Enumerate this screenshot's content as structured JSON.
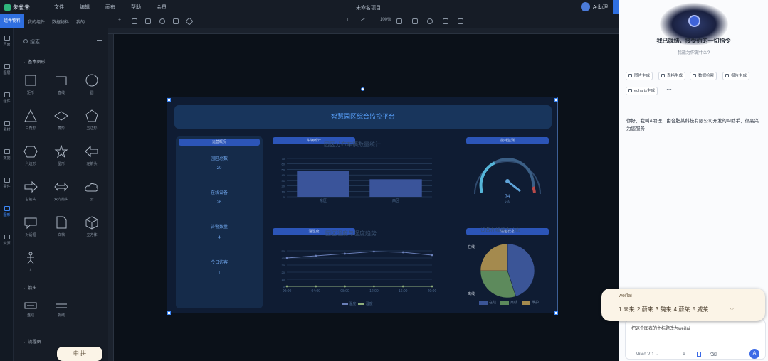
{
  "app": {
    "name": "朱雀朱",
    "menu": [
      "文件",
      "编辑",
      "画布",
      "帮助",
      "会员"
    ],
    "project_title": "未命名项目",
    "user": "A·助理"
  },
  "left_tabs": [
    "组件物料",
    "我的组件",
    "数据物料",
    "我的"
  ],
  "rail": [
    {
      "label": "页面",
      "active": false
    },
    {
      "label": "图层",
      "active": false
    },
    {
      "label": "组件",
      "active": false
    },
    {
      "label": "素材",
      "active": false
    },
    {
      "label": "数据",
      "active": false
    },
    {
      "label": "事件",
      "active": false
    },
    {
      "label": "图形",
      "active": true
    },
    {
      "label": "资源",
      "active": false
    }
  ],
  "palette": {
    "search_placeholder": "搜索",
    "section_basic": "基本图形",
    "section_arrow": "箭头",
    "section_more": "流程图",
    "shapes": [
      "矩形",
      "直线",
      "圆",
      "三角形",
      "菱形",
      "五边形",
      "六边形",
      "星形",
      "左箭头",
      "右箭头",
      "双向箭头",
      "云",
      "对话框",
      "文档",
      "立方体",
      "人"
    ],
    "arrows": [
      "连线",
      "折线"
    ],
    "ime_badge": "中 拼"
  },
  "toolbar": {
    "zoom": "100%",
    "text_tool": "T"
  },
  "dashboard": {
    "title": "智慧园区综合监控平台",
    "left_card_chip": "运营概况",
    "left_items": [
      {
        "label": "园区总数",
        "value": "20"
      },
      {
        "label": "在线设备",
        "value": "26"
      },
      {
        "label": "告警数量",
        "value": "4"
      },
      {
        "label": "今日访客",
        "value": "1"
      }
    ],
    "bar_chip": "车辆统计",
    "bar_ghost": "园区分布车辆数量统计",
    "gauge_chip": "能耗监测",
    "gauge_value": "74",
    "gauge_unit": "kW",
    "line_chip": "温湿度",
    "line_ghost": "园区温度与湿度趋势",
    "pie_chip": "设备状态",
    "pie_ghost": "设备在线状态分布",
    "line_legend": [
      "温度",
      "湿度"
    ],
    "pie_legend": [
      "在线",
      "离线",
      "维护"
    ],
    "pie_labels": [
      "在线",
      "离线"
    ]
  },
  "chart_data": [
    {
      "type": "bar",
      "categories": [
        "东区",
        "西区"
      ],
      "values": [
        48,
        32
      ],
      "ylim": [
        0,
        70
      ],
      "yticks": [
        "0",
        "10",
        "20",
        "30",
        "40",
        "50",
        "60",
        "70"
      ]
    },
    {
      "type": "line",
      "x": [
        "00:00",
        "04:00",
        "08:00",
        "12:00",
        "16:00",
        "20:00"
      ],
      "series": [
        {
          "name": "温度",
          "values": [
            40,
            43,
            46,
            49,
            48,
            44
          ]
        },
        {
          "name": "湿度",
          "values": [
            0,
            0,
            0,
            0,
            0,
            0
          ]
        }
      ],
      "ylim": [
        0,
        50
      ],
      "yticks": [
        "0",
        "10",
        "20",
        "30",
        "40",
        "50"
      ]
    },
    {
      "type": "pie",
      "labels": [
        "在线",
        "离线",
        "维护"
      ],
      "values": [
        45,
        30,
        25
      ],
      "colors": [
        "#3b5597",
        "#5d8a5c",
        "#a48a4e"
      ]
    }
  ],
  "assistant": {
    "headline": "我已就绪，接受你的一切指令",
    "sub": "我能为你做什么?",
    "quick": [
      "图片生成",
      "表格生成",
      "数据检索",
      "报告生成",
      "echarts生成"
    ],
    "message": "你好，我叫A助理，由合肥某科技有限公司开发的AI助手，很高兴为您服务！",
    "input_text": "把这个图表的主标题改为wei'lai",
    "model": "MiMo V·1"
  },
  "ime": {
    "composition": "wei'lai",
    "candidates": "1.未来 2.蔚来 3.魏来 4.蔚莱 5.威莱"
  },
  "colors": {
    "accent": "#2f6fe0",
    "canvas": "#0b1119",
    "panel": "#161c26"
  }
}
